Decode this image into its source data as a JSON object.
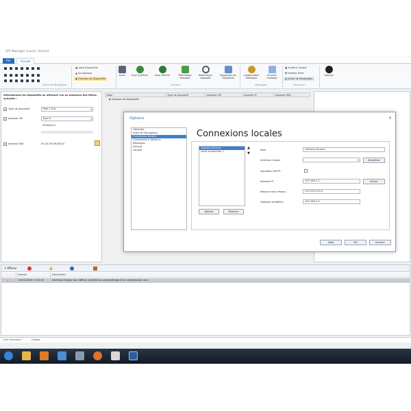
{
  "window": {
    "title": "VIP Manager [Local, Online]"
  },
  "menu": {
    "file": "File",
    "accueil": "Accueil"
  },
  "ribbon": {
    "list": [
      "Liste Dispositifs",
      "Synoptique",
      "Groupes de Dispositifs"
    ],
    "buttons": [
      {
        "label": "Local",
        "icon": "computer-icon",
        "color": "#5a6778"
      },
      {
        "label": "Scan Système",
        "icon": "globe-scan-icon",
        "color": "#3a8a3a"
      },
      {
        "label": "Scan Sélectif",
        "icon": "globe-select-icon",
        "color": "#2f7a3a"
      },
      {
        "label": "Télécharger firmware",
        "icon": "download-icon",
        "color": "#4f9a4f"
      },
      {
        "label": "Redémarrer dispositif",
        "icon": "restart-icon",
        "color": "#505a66"
      },
      {
        "label": "Regrouper les Dispositifs",
        "icon": "group-icon",
        "color": "#6a8fc8"
      },
      {
        "label": "Configuration Messages",
        "icon": "magnifier-icon",
        "color": "#c79a2a"
      },
      {
        "label": "Envoyer message",
        "icon": "envelope-icon",
        "color": "#8fb3e0"
      }
    ],
    "view_items": [
      "Fenêtre Output",
      "Fenêtre Filtre",
      "Arbre de Navigation"
    ],
    "options_label": "Options",
    "groups": [
      "Arbre de Navigation",
      "Actions",
      "Messages",
      "Visualiser"
    ]
  },
  "filter_panel": {
    "heading": "Sélectionnez les dispositifs en utilisant l'un ou plusieurs des filtres suivants :",
    "type_label": "Type de dispositif",
    "type_value": "MaX / 316",
    "ip_label": "Adresse VIP",
    "ip_value": "Égal à",
    "ip_input": "0000000:1",
    "mac_label": "Adresse MAC",
    "mac_value": "00:25:29:06:4B:D2"
  },
  "device_table": {
    "headers": [
      "Nom",
      "Type de dispositif",
      "Adresse VIP",
      "Adresse IP",
      "Adresse MAC"
    ],
    "first_row": "Groupes de Dispositifs"
  },
  "dialog": {
    "title": "Options",
    "nav_items": [
      "Générale",
      "Arbre de Navigation",
      "Connexions locales",
      "Connexions à distance",
      "Messages",
      "Avancé",
      "Langue"
    ],
    "selected_nav": 2,
    "heading": "Connexions locales",
    "connections": [
      "Gateway Bureau",
      "Local connection 1"
    ],
    "add_label": "Ajouter",
    "remove_label": "Éliminer",
    "fields": {
      "name_label": "Nom",
      "name_value": "Gateway Bureau",
      "iface_label": "Interface réseau",
      "iface_value": "",
      "refresh_label": "Actualiser",
      "dhcp_label": "Validation DHCP:",
      "ip_label": "Adresse IP:",
      "ip_value": "192.168.1.2",
      "assign_label": "Actuer",
      "mask_label": "Masque sous-réseau:",
      "mask_value": "255.255.255.0",
      "gw_label": "Gateway prédéfini:",
      "gw_value": "192.168.1.0"
    },
    "help_label": "Help",
    "ok_label": "OK",
    "cancel_label": "Annuler"
  },
  "messages": {
    "clear_label": "Effacer",
    "headers": [
      "",
      "Horaire",
      "Description"
    ],
    "row": {
      "time": "10/01/2016 17:31:10",
      "text": "Interface réseau non définie. Accédez au paramétrage et en sélectionner une."
    }
  },
  "bottom_tabs": [
    "Liste Messages",
    "Output"
  ],
  "taskbar": {
    "icons": [
      {
        "name": "windows-start-icon",
        "color": "#3a82d8"
      },
      {
        "name": "folder-icon",
        "color": "#e2b84a"
      },
      {
        "name": "media-player-icon",
        "color": "#e07a2a"
      },
      {
        "name": "network-icon",
        "color": "#4a8fd6"
      },
      {
        "name": "tools-icon",
        "color": "#8a9aae"
      },
      {
        "name": "firefox-icon",
        "color": "#e0702a"
      },
      {
        "name": "file-icon",
        "color": "#d8d8d8"
      },
      {
        "name": "vip-manager-icon",
        "color": "#2d5fa0"
      }
    ]
  }
}
